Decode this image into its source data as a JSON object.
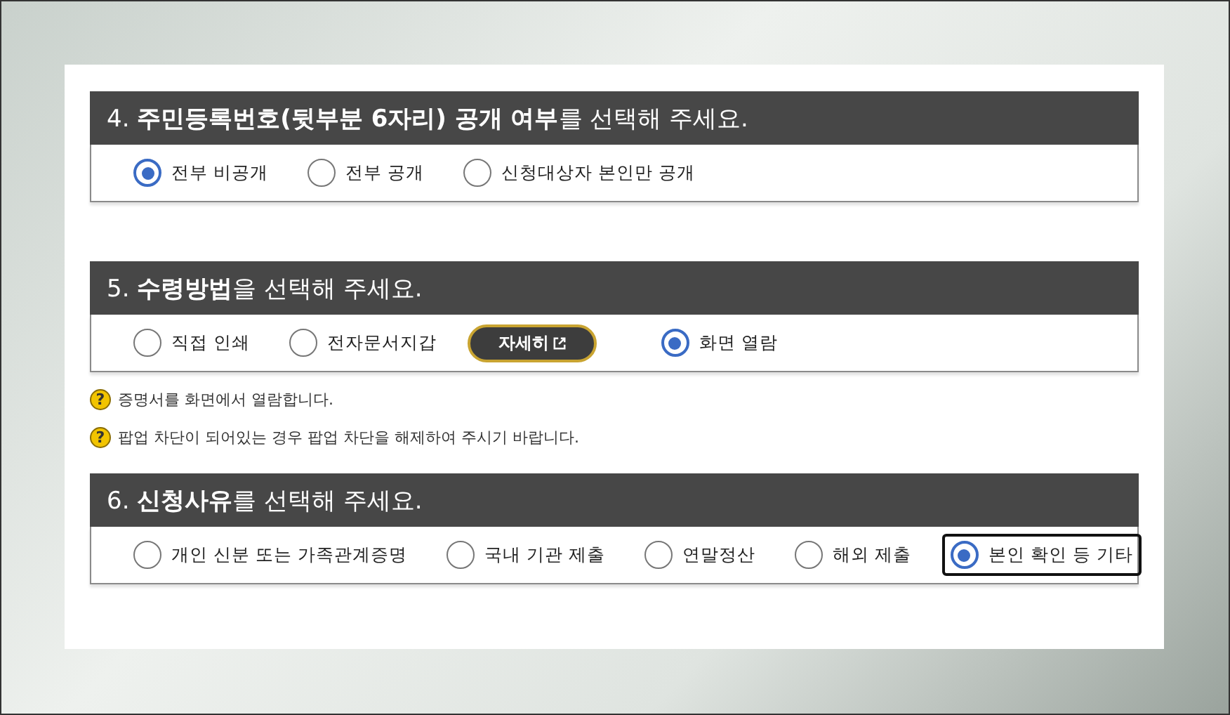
{
  "sections": [
    {
      "title": "4. **주민등록번호(뒷부분 6자리) 공개 여부**를 선택해 주세요.",
      "options": [
        {
          "kind": "radio",
          "label": "전부 비공개",
          "selected": true,
          "focused": false
        },
        {
          "kind": "radio",
          "label": "전부 공개",
          "selected": false,
          "focused": false
        },
        {
          "kind": "radio",
          "label": "신청대상자 본인만 공개",
          "selected": false,
          "focused": false
        }
      ]
    },
    {
      "title": "5. **수령방법**을 선택해 주세요.",
      "options": [
        {
          "kind": "radio",
          "label": "직접 인쇄",
          "selected": false,
          "focused": false
        },
        {
          "kind": "radio",
          "label": "전자문서지갑",
          "selected": false,
          "focused": false
        },
        {
          "kind": "button",
          "label": "자세히"
        },
        {
          "kind": "radio",
          "label": "화면 열람",
          "selected": true,
          "focused": false
        }
      ],
      "notes": [
        {
          "icon": "?",
          "text": "증명서를 화면에서 열람합니다."
        },
        {
          "icon": "?",
          "text": "팝업 차단이 되어있는 경우 팝업 차단을 해제하여 주시기 바랍니다."
        }
      ]
    },
    {
      "title": "6. **신청사유**를 선택해 주세요.",
      "options": [
        {
          "kind": "radio",
          "label": "개인 신분 또는 가족관계증명",
          "selected": false,
          "focused": false
        },
        {
          "kind": "radio",
          "label": "국내 기관 제출",
          "selected": false,
          "focused": false
        },
        {
          "kind": "radio",
          "label": "연말정산",
          "selected": false,
          "focused": false
        },
        {
          "kind": "radio",
          "label": "해외 제출",
          "selected": false,
          "focused": false
        },
        {
          "kind": "radio",
          "label": "본인 확인 등 기타",
          "selected": true,
          "focused": true
        }
      ]
    }
  ]
}
